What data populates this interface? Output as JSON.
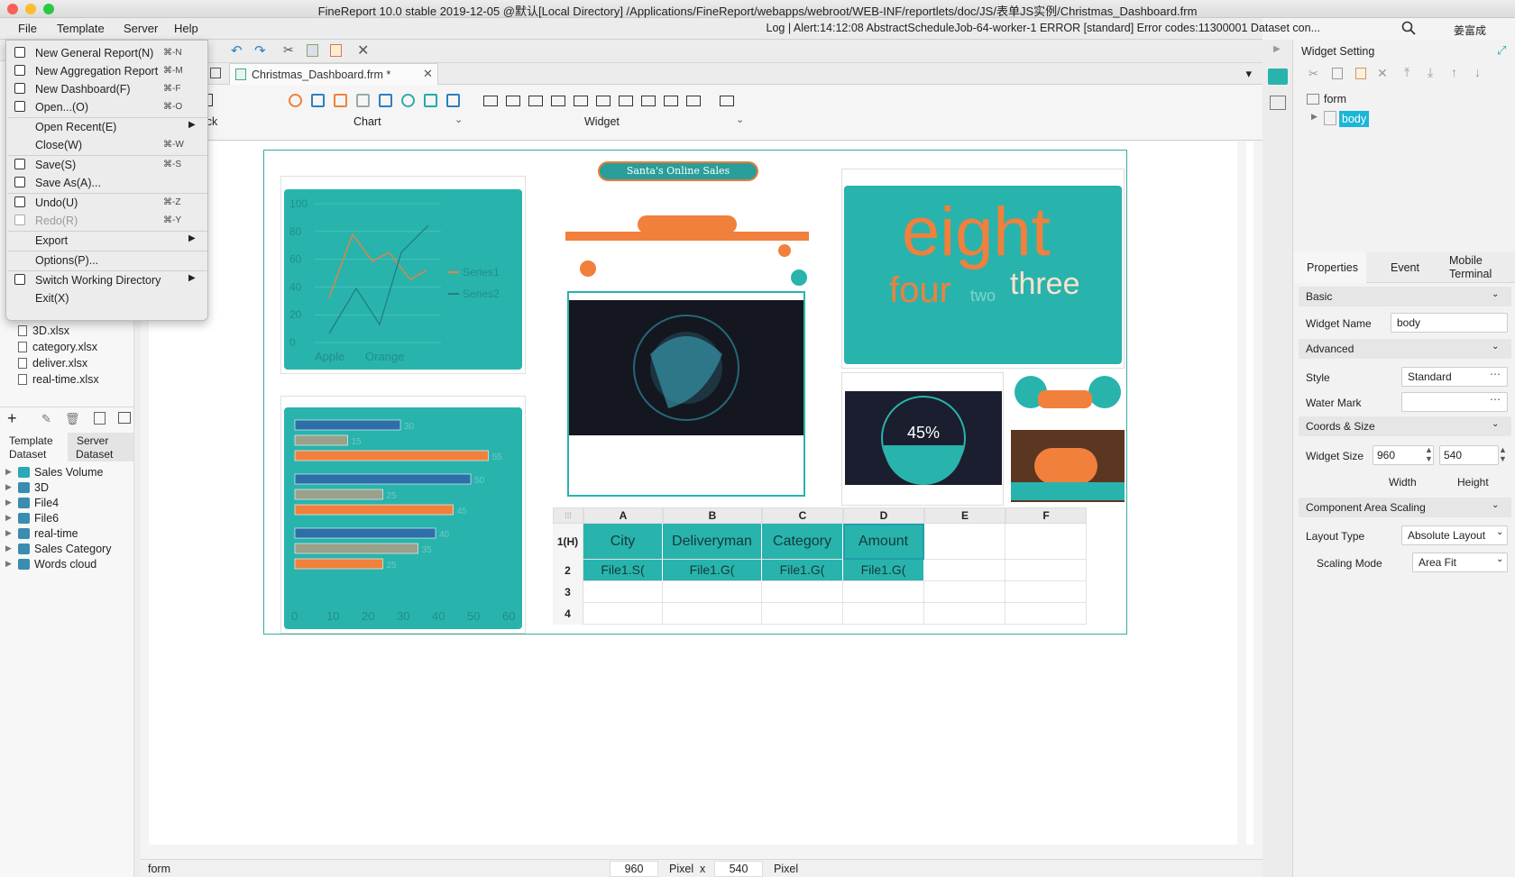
{
  "window": {
    "title": "FineReport 10.0 stable 2019-12-05 @默认[Local Directory]    /Applications/FineReport/webapps/webroot/WEB-INF/reportlets/doc/JS/表单JS实例/Christmas_Dashboard.frm"
  },
  "menubar": {
    "items": [
      "File",
      "Template",
      "Server",
      "Help"
    ],
    "alert": "Log | Alert:14:12:08 AbstractScheduleJob-64-worker-1 ERROR [standard] Error codes:11300001 Dataset con...",
    "user": "姜富成"
  },
  "file_menu": {
    "items": [
      {
        "label": "New General Report(N)",
        "shortcut": "⌘-N",
        "icon": "report-icon"
      },
      {
        "label": "New Aggregation Report",
        "shortcut": "⌘-M",
        "icon": "aggregation-icon"
      },
      {
        "label": "New Dashboard(F)",
        "shortcut": "⌘-F",
        "icon": "dashboard-icon"
      },
      {
        "label": "Open...(O)",
        "shortcut": "⌘-O",
        "icon": "folder-open-icon"
      },
      {
        "label": "Open Recent(E)",
        "shortcut": "",
        "icon": "",
        "submenu": true
      },
      {
        "label": "Close(W)",
        "shortcut": "⌘-W",
        "icon": ""
      },
      {
        "label": "Save(S)",
        "shortcut": "⌘-S",
        "icon": "save-icon"
      },
      {
        "label": "Save As(A)...",
        "shortcut": "",
        "icon": "save-as-icon"
      },
      {
        "label": "Undo(U)",
        "shortcut": "⌘-Z",
        "icon": "undo-icon"
      },
      {
        "label": "Redo(R)",
        "shortcut": "⌘-Y",
        "icon": "redo-icon",
        "disabled": true
      },
      {
        "label": "Export",
        "shortcut": "",
        "icon": "",
        "submenu": true
      },
      {
        "label": "Options(P)...",
        "shortcut": "",
        "icon": ""
      },
      {
        "label": "Switch Working Directory",
        "shortcut": "",
        "icon": "switch-icon",
        "submenu": true
      },
      {
        "label": "Exit(X)",
        "shortcut": "",
        "icon": ""
      }
    ]
  },
  "file_tree": {
    "items": [
      "3D.xlsx",
      "category.xlsx",
      "deliver.xlsx",
      "real-time.xlsx"
    ]
  },
  "dataset_panel": {
    "tabs": [
      "Template\nDataset",
      "Server\nDataset"
    ],
    "tab_template_1": "Template",
    "tab_template_2": "Dataset",
    "tab_server_1": "Server",
    "tab_server_2": "Dataset",
    "items": [
      "Sales Volume",
      "3D",
      "File4",
      "File6",
      "real-time",
      "Sales Category",
      "Words cloud"
    ]
  },
  "doc_tab": {
    "label": "Christmas_Dashboard.frm *"
  },
  "palette": {
    "groups": [
      "Blank Block",
      "Chart",
      "Widget"
    ]
  },
  "dashboard": {
    "banner": "Santa's Online Sales",
    "wordcloud": [
      "eight",
      "four",
      "two",
      "three"
    ],
    "gauge": "45%",
    "line_chart": {
      "y_ticks": [
        "100",
        "80",
        "60",
        "40",
        "20",
        "0"
      ],
      "x_ticks": [
        "Apple",
        "Orange"
      ],
      "legend": [
        "Series1",
        "Series2"
      ]
    },
    "bar_chart": {
      "x_ticks": [
        "0",
        "10",
        "20",
        "30",
        "40",
        "50",
        "60"
      ],
      "values": [
        30,
        15,
        55,
        50,
        25,
        45,
        40,
        35,
        25
      ],
      "labels": [
        "30",
        "15",
        "55",
        "50",
        "25",
        "45",
        "40",
        "35",
        "25"
      ]
    },
    "grid": {
      "cols": [
        "A",
        "B",
        "C",
        "D",
        "E",
        "F"
      ],
      "rows": [
        "1(H)",
        "2",
        "3",
        "4"
      ],
      "headers": [
        "City",
        "Deliveryman",
        "Category",
        "Amount"
      ],
      "cells": [
        "File1.S(",
        "File1.G(",
        "File1.G(",
        "File1.G("
      ]
    }
  },
  "statusbar": {
    "left": "form",
    "width": "960",
    "unit1": "Pixel",
    "x": "x",
    "height": "540",
    "unit2": "Pixel"
  },
  "right_panel": {
    "title": "Widget Setting",
    "tree_root": "form",
    "tree_child": "body",
    "tabs": [
      "Properties",
      "Event",
      "Mobile\nTerminal"
    ],
    "tab_mobile_1": "Mobile",
    "tab_mobile_2": "Terminal",
    "basic": "Basic",
    "widget_name_label": "Widget Name",
    "widget_name_value": "body",
    "advanced": "Advanced",
    "style_label": "Style",
    "style_value": "Standard",
    "watermark_label": "Water Mark",
    "coords_size": "Coords & Size",
    "widget_size_label": "Widget Size",
    "width_value": "960",
    "height_value": "540",
    "width_label": "Width",
    "height_label": "Height",
    "area_scaling": "Component Area Scaling",
    "layout_type_label": "Layout Type",
    "layout_type_value": "Absolute Layout",
    "scaling_mode_label": "Scaling Mode",
    "scaling_mode_value": "Area Fit"
  },
  "colors": {
    "teal": "#29b3ad",
    "orange": "#f0803c",
    "dark": "#1b1e2e"
  }
}
